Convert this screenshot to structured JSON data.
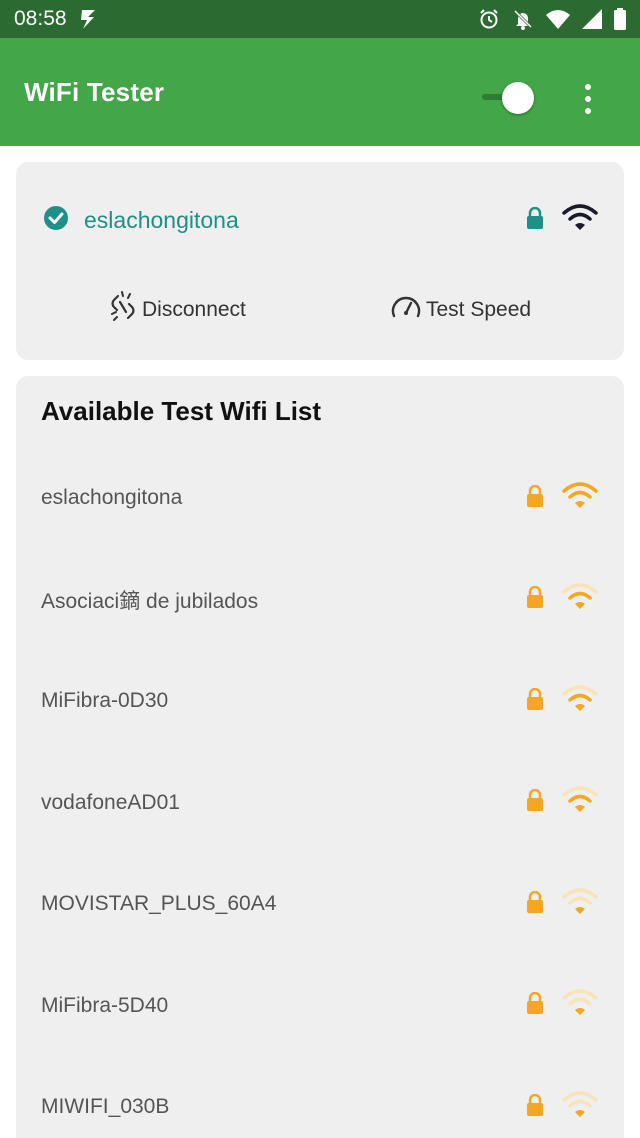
{
  "status_bar": {
    "time": "08:58",
    "icons": [
      "flash-icon",
      "alarm-icon",
      "notifications-off-icon",
      "wifi-icon",
      "cell-signal-icon",
      "battery-icon"
    ]
  },
  "app_bar": {
    "title": "WiFi Tester",
    "toggle_on": true,
    "colors": {
      "app_bar": "#43a649",
      "status_bar": "#2b6a31"
    }
  },
  "connected": {
    "ssid": "eslachongitona",
    "secured": true,
    "color": "#1e9088",
    "actions": {
      "disconnect_label": "Disconnect",
      "test_speed_label": "Test Speed"
    }
  },
  "wifi_list": {
    "heading": "Available Test Wifi List",
    "accent": "#f5a623",
    "items": [
      {
        "ssid": "eslachongitona",
        "secured": true,
        "signal_bars": 3
      },
      {
        "ssid": "Asociaci鏑 de jubilados",
        "secured": true,
        "signal_bars": 2
      },
      {
        "ssid": "MiFibra-0D30",
        "secured": true,
        "signal_bars": 2
      },
      {
        "ssid": "vodafoneAD01",
        "secured": true,
        "signal_bars": 2
      },
      {
        "ssid": "MOVISTAR_PLUS_60A4",
        "secured": true,
        "signal_bars": 1
      },
      {
        "ssid": "MiFibra-5D40",
        "secured": true,
        "signal_bars": 1
      },
      {
        "ssid": "MIWIFI_030B",
        "secured": true,
        "signal_bars": 1
      }
    ]
  }
}
